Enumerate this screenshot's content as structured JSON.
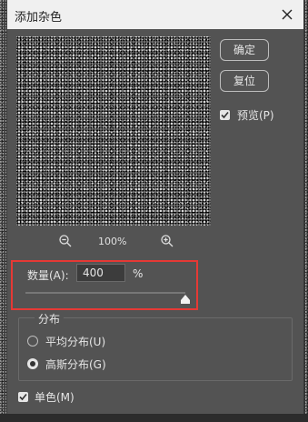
{
  "window": {
    "title": "添加杂色"
  },
  "buttons": {
    "ok_label": "确定",
    "reset_label": "复位"
  },
  "preview_toggle": {
    "label": "预览(P)",
    "checked": true
  },
  "zoom": {
    "value": "100%"
  },
  "amount": {
    "label": "数量(A):",
    "value": "400",
    "unit": "%",
    "fraction": 1.0
  },
  "distribution": {
    "title": "分布",
    "options": [
      {
        "label": "平均分布(U)",
        "selected": false
      },
      {
        "label": "高斯分布(G)",
        "selected": true
      }
    ]
  },
  "monochrome": {
    "label": "单色(M)",
    "checked": true
  },
  "colors": {
    "highlight_box": "#e53935",
    "dialog_bg": "#535353"
  }
}
